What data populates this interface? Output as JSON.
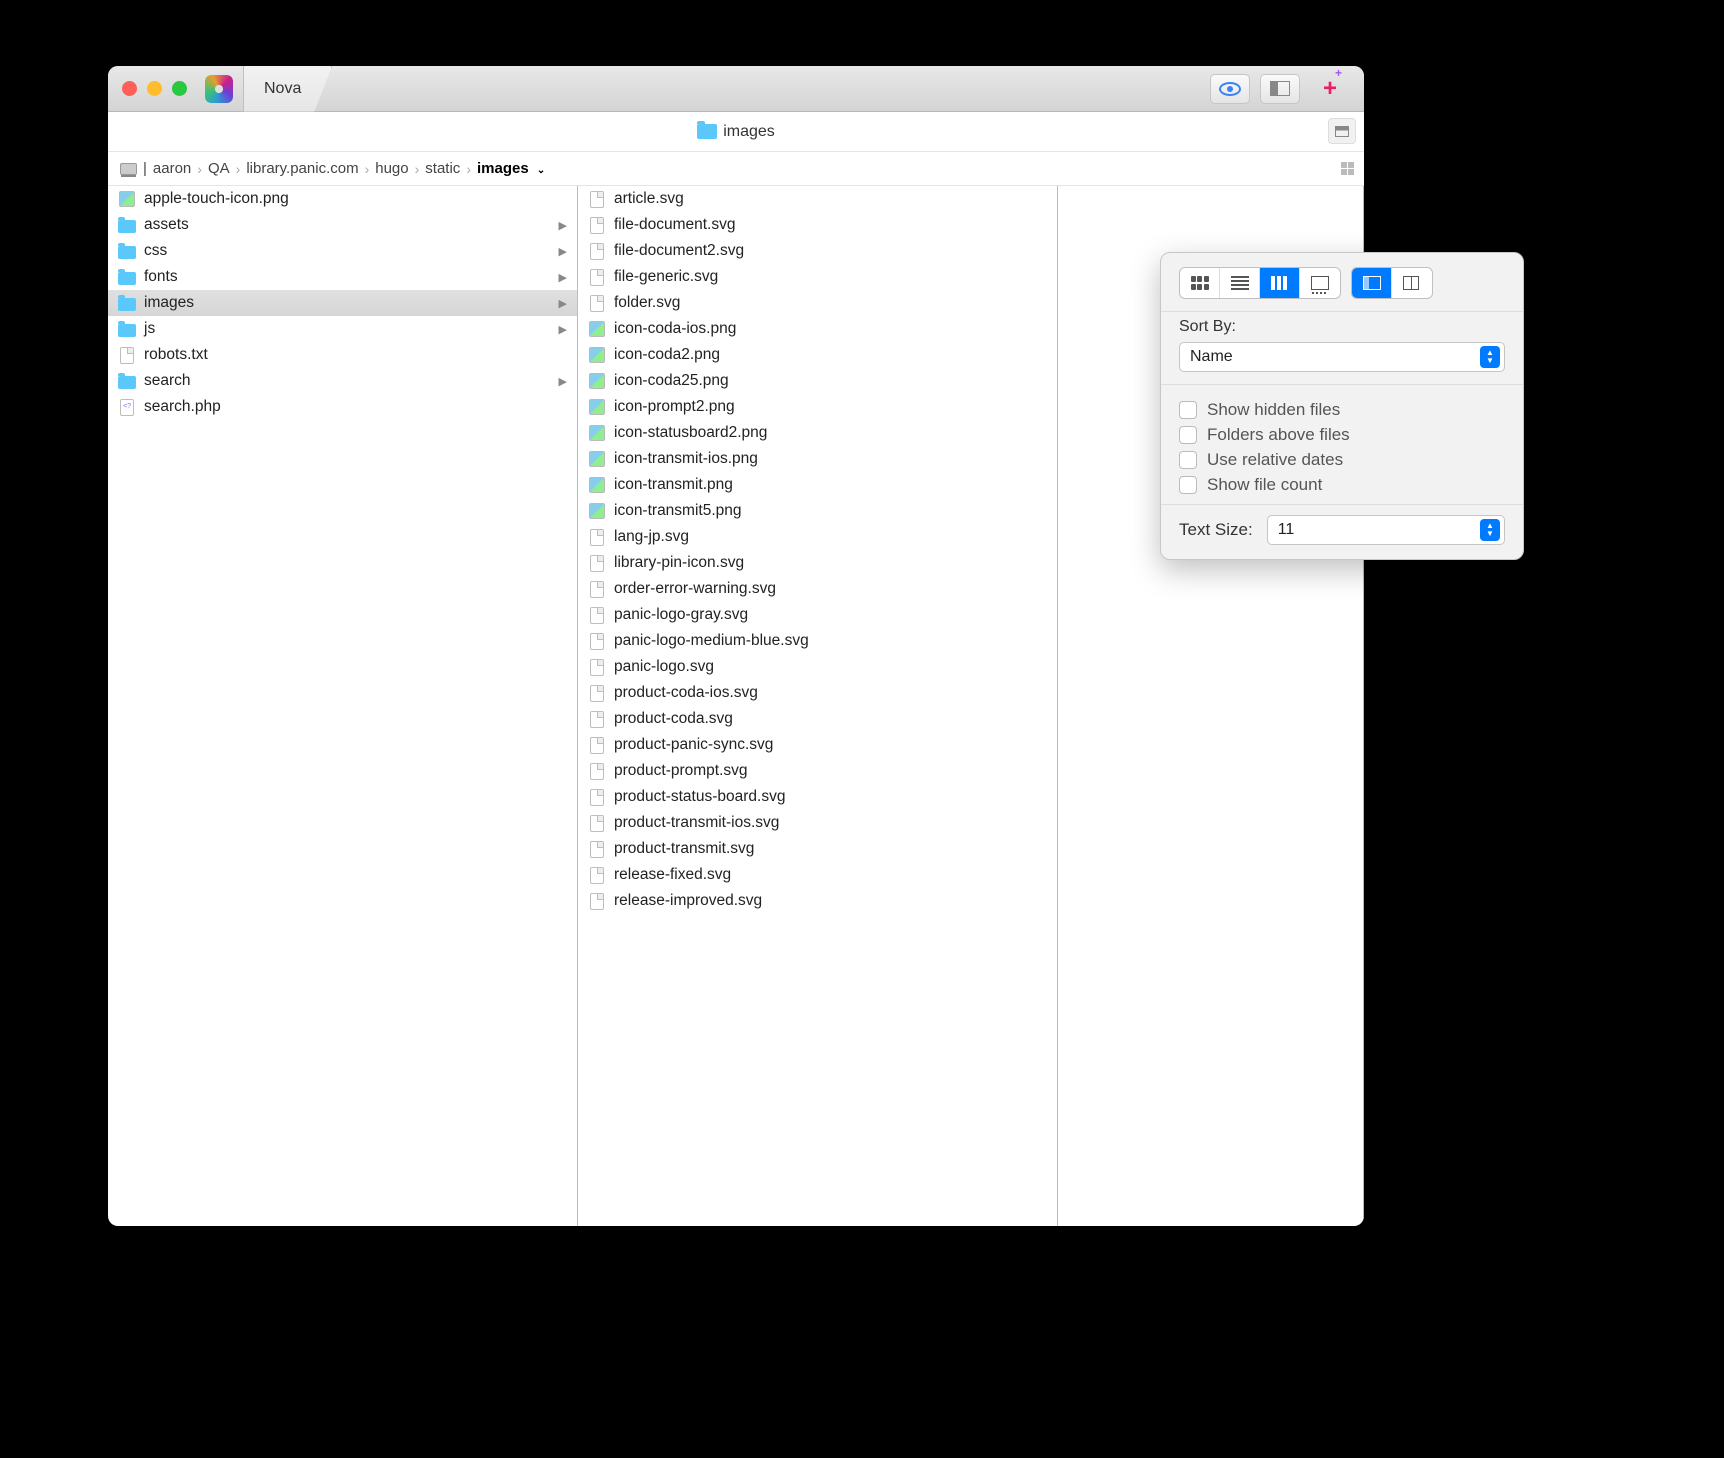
{
  "tab": {
    "title": "Nova"
  },
  "pathbar": {
    "current": "images"
  },
  "breadcrumb": {
    "items": [
      "aaron",
      "QA",
      "library.panic.com",
      "hugo",
      "static"
    ],
    "current": "images"
  },
  "column1": [
    {
      "name": "apple-touch-icon.png",
      "icon": "png",
      "expandable": false,
      "selected": false
    },
    {
      "name": "assets",
      "icon": "folder",
      "expandable": true,
      "selected": false
    },
    {
      "name": "css",
      "icon": "folder",
      "expandable": true,
      "selected": false
    },
    {
      "name": "fonts",
      "icon": "folder",
      "expandable": true,
      "selected": false
    },
    {
      "name": "images",
      "icon": "folder",
      "expandable": true,
      "selected": true
    },
    {
      "name": "js",
      "icon": "folder",
      "expandable": true,
      "selected": false
    },
    {
      "name": "robots.txt",
      "icon": "file",
      "expandable": false,
      "selected": false
    },
    {
      "name": "search",
      "icon": "folder",
      "expandable": true,
      "selected": false
    },
    {
      "name": "search.php",
      "icon": "php",
      "expandable": false,
      "selected": false
    }
  ],
  "column2": [
    {
      "name": "article.svg",
      "icon": "file"
    },
    {
      "name": "file-document.svg",
      "icon": "file"
    },
    {
      "name": "file-document2.svg",
      "icon": "file"
    },
    {
      "name": "file-generic.svg",
      "icon": "file"
    },
    {
      "name": "folder.svg",
      "icon": "file"
    },
    {
      "name": "icon-coda-ios.png",
      "icon": "png"
    },
    {
      "name": "icon-coda2.png",
      "icon": "png"
    },
    {
      "name": "icon-coda25.png",
      "icon": "png"
    },
    {
      "name": "icon-prompt2.png",
      "icon": "png"
    },
    {
      "name": "icon-statusboard2.png",
      "icon": "png"
    },
    {
      "name": "icon-transmit-ios.png",
      "icon": "png"
    },
    {
      "name": "icon-transmit.png",
      "icon": "png"
    },
    {
      "name": "icon-transmit5.png",
      "icon": "png"
    },
    {
      "name": "lang-jp.svg",
      "icon": "file"
    },
    {
      "name": "library-pin-icon.svg",
      "icon": "file"
    },
    {
      "name": "order-error-warning.svg",
      "icon": "file"
    },
    {
      "name": "panic-logo-gray.svg",
      "icon": "file"
    },
    {
      "name": "panic-logo-medium-blue.svg",
      "icon": "file"
    },
    {
      "name": "panic-logo.svg",
      "icon": "file"
    },
    {
      "name": "product-coda-ios.svg",
      "icon": "file"
    },
    {
      "name": "product-coda.svg",
      "icon": "file"
    },
    {
      "name": "product-panic-sync.svg",
      "icon": "file"
    },
    {
      "name": "product-prompt.svg",
      "icon": "file"
    },
    {
      "name": "product-status-board.svg",
      "icon": "file"
    },
    {
      "name": "product-transmit-ios.svg",
      "icon": "file"
    },
    {
      "name": "product-transmit.svg",
      "icon": "file"
    },
    {
      "name": "release-fixed.svg",
      "icon": "file"
    },
    {
      "name": "release-improved.svg",
      "icon": "file"
    }
  ],
  "popover": {
    "sort_by_label": "Sort By:",
    "sort_by_value": "Name",
    "checks": [
      "Show hidden files",
      "Folders above files",
      "Use relative dates",
      "Show file count"
    ],
    "text_size_label": "Text Size:",
    "text_size_value": "11"
  }
}
